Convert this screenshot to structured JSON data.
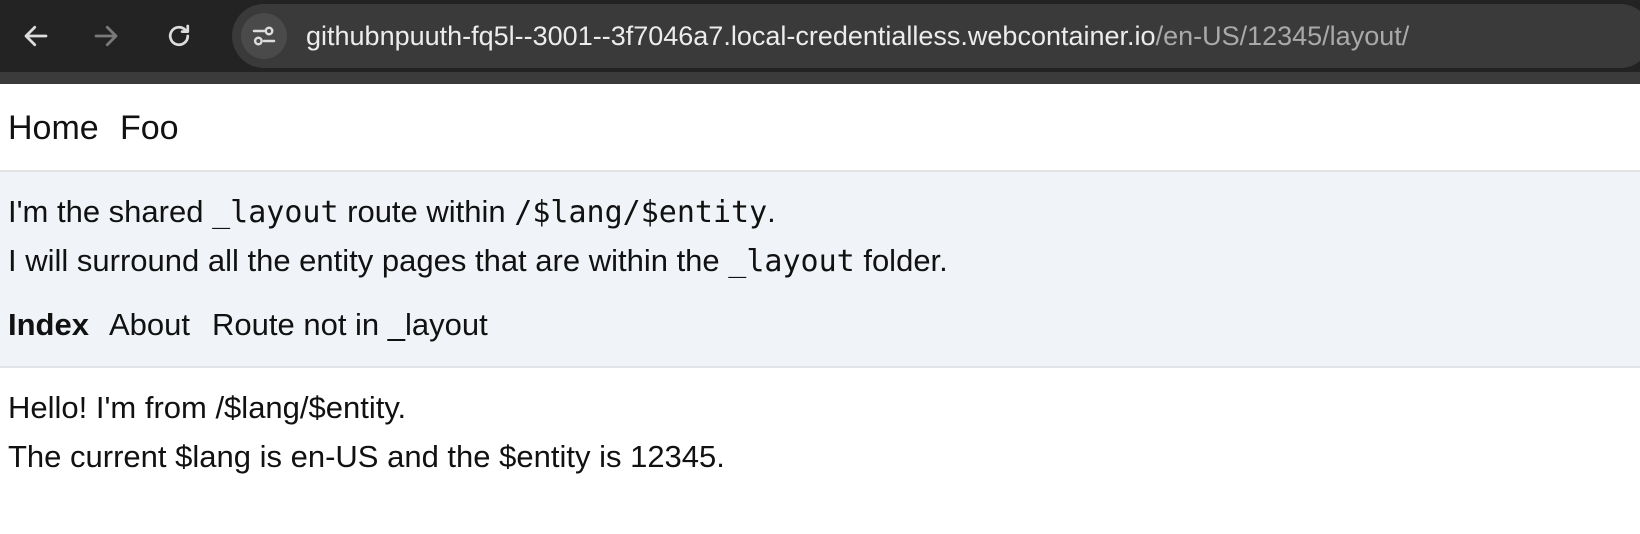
{
  "browser": {
    "url_host": "githubnpuuth-fq5l--3001--3f7046a7.local-credentialless.webcontainer.io",
    "url_path": "/en-US/12345/layout/",
    "icons": [
      "back-arrow-icon",
      "forward-arrow-icon",
      "reload-icon",
      "site-settings-icon"
    ],
    "colors": {
      "toolbar": "#232323",
      "omnibox": "#3a3a3a",
      "url_host": "#ececec",
      "url_path": "#a9a9a9"
    }
  },
  "root_nav": {
    "home": "Home",
    "foo": "Foo"
  },
  "layout": {
    "line1_prefix": "I'm the shared ",
    "line1_code1": "_layout",
    "line1_mid": " route within ",
    "line1_code2": "/$lang/$entity",
    "line1_suffix": ".",
    "line2_prefix": "I will surround all the entity pages that are within the ",
    "line2_code": "_layout",
    "line2_suffix": " folder.",
    "nav": {
      "index": "Index",
      "about": "About",
      "route_not_in_layout": "Route not in _layout"
    },
    "background": "#f0f4f8"
  },
  "content": {
    "hello": "Hello! I'm from /$lang/$entity.",
    "current_prefix": "The current $lang is ",
    "lang_value": "en-US",
    "current_mid": " and the $entity is ",
    "entity_value": "12345",
    "current_suffix": "."
  }
}
